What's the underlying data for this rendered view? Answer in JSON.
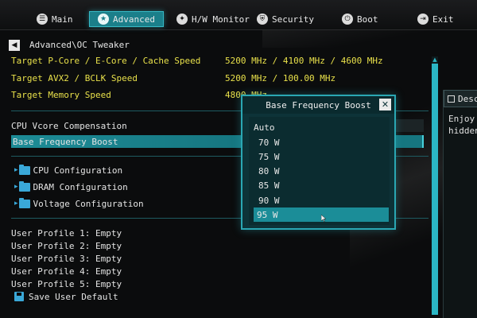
{
  "nav": {
    "tabs": [
      {
        "label": "Main",
        "icon": "menu-icon"
      },
      {
        "label": "Advanced",
        "icon": "star-icon",
        "active": true
      },
      {
        "label": "H/W Monitor",
        "icon": "monitor-icon"
      },
      {
        "label": "Security",
        "icon": "shield-icon"
      },
      {
        "label": "Boot",
        "icon": "power-icon"
      },
      {
        "label": "Exit",
        "icon": "exit-icon"
      }
    ]
  },
  "breadcrumb": "Advanced\\OC Tweaker",
  "targets": [
    {
      "label": "Target P-Core / E-Core / Cache Speed",
      "value": "5200 MHz / 4100 MHz / 4600 MHz"
    },
    {
      "label": "Target AVX2 / BCLK Speed",
      "value": "5200 MHz / 100.00 MHz"
    },
    {
      "label": "Target Memory Speed",
      "value": "4800 MHz"
    }
  ],
  "settings": [
    {
      "label": "CPU Vcore Compensation"
    },
    {
      "label": "Base Frequency Boost",
      "selected": true
    }
  ],
  "submenus": [
    {
      "label": "CPU Configuration"
    },
    {
      "label": "DRAM Configuration"
    },
    {
      "label": "Voltage Configuration"
    }
  ],
  "profiles": [
    "User Profile 1: Empty",
    "User Profile 2: Empty",
    "User Profile 3: Empty",
    "User Profile 4: Empty",
    "User Profile 5: Empty"
  ],
  "save_default": "Save User Default",
  "description": {
    "title": "Desc",
    "lines": [
      "Enjoy t",
      "hidden"
    ]
  },
  "popup": {
    "title": "Base Frequency Boost",
    "options": [
      "Auto",
      "70 W",
      "75 W",
      "80 W",
      "85 W",
      "90 W",
      "95 W"
    ],
    "selected_index": 6
  },
  "colors": {
    "accent": "#1b8d98",
    "highlight_text": "#e8e04a",
    "folder_icon": "#3aa8d8"
  }
}
